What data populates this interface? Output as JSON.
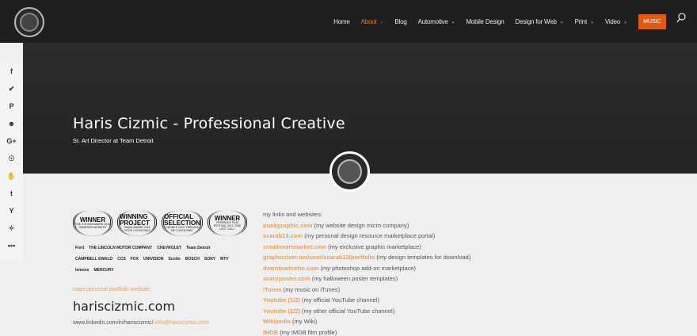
{
  "nav": {
    "items": [
      {
        "label": "Home",
        "chevron": false
      },
      {
        "label": "About",
        "chevron": true,
        "active": true
      },
      {
        "label": "Blog",
        "chevron": false
      },
      {
        "label": "Automotive",
        "chevron": true
      },
      {
        "label": "Mobile Design",
        "chevron": false
      },
      {
        "label": "Design for Web",
        "chevron": true
      },
      {
        "label": "Print",
        "chevron": true
      },
      {
        "label": "Video",
        "chevron": true
      }
    ],
    "music_label": "MUSIC"
  },
  "hero": {
    "title": "Haris Cizmic - Professional Creative",
    "subtitle": "Sr. Art Director at Team Detroit"
  },
  "share": [
    "f",
    "✔",
    "P",
    "☻",
    "G+",
    "☉",
    "✋",
    "t",
    "Y",
    "✧",
    "•••"
  ],
  "laurels": [
    {
      "title": "WINNER",
      "sub": "THE 8 SHOW AWARD 2016 \"WARRIOR WEBSITE\""
    },
    {
      "title": "WINNING PROJECT",
      "sub": "OMMA AWARD 2016 \"STOP LOCKDOWN\""
    },
    {
      "title": "OFFICIAL SELECTION",
      "sub": "CANNES 2010 \"OBRADIŠ ME LOCKDOWN\""
    },
    {
      "title": "WINNER",
      "sub": "FERNDALE FILM FESTIVAL 2011 \"ONE LAST CALL\""
    }
  ],
  "brands": [
    "Ford",
    "THE LINCOLN MOTOR COMPANY",
    "CHEVROLET",
    "Team Detroit",
    "CAMPBELL EWALD",
    "CCS",
    "FOX",
    "UNIVISION",
    "Scotts",
    "BOSCH",
    "SONY",
    "MTV",
    "lemons",
    "MERCURY"
  ],
  "portfolio": {
    "label": "main personal portfolio website:",
    "site": "hariscizmic.com",
    "linkedin": "www.linkedin.com/in/hariscizmic/",
    "email": "info@hariscizmic.com"
  },
  "links": {
    "heading": "my links and websites:",
    "items": [
      {
        "name": "punkgraphic.com",
        "desc": " (my website design micro company)"
      },
      {
        "name": "scarab13.com",
        "desc": " (my personal design resource marketplace portal)"
      },
      {
        "name": "creativeartmarket.com",
        "desc": " (my exclusive graphic marketplace)"
      },
      {
        "name": "graphicriver.net/user/scarab13/portfolio",
        "desc": " (my design templates for download)"
      },
      {
        "name": "downloadsoho.com",
        "desc": " (my photoshop add-on marketplace)"
      },
      {
        "name": "scaryposter.com",
        "desc": " (my halloween poster templates)"
      },
      {
        "name": "iTunes",
        "desc": " (my music on iTunes)"
      },
      {
        "name": "Youtube (1/2)",
        "desc": " (my official YouTube channel)"
      },
      {
        "name": "Youtube (2/2)",
        "desc": " (my other official YouTube channel)"
      },
      {
        "name": "Wikipedia",
        "desc": " (my Wiki)"
      },
      {
        "name": "IMDB",
        "desc": " (my IMDB film profile)"
      }
    ]
  }
}
